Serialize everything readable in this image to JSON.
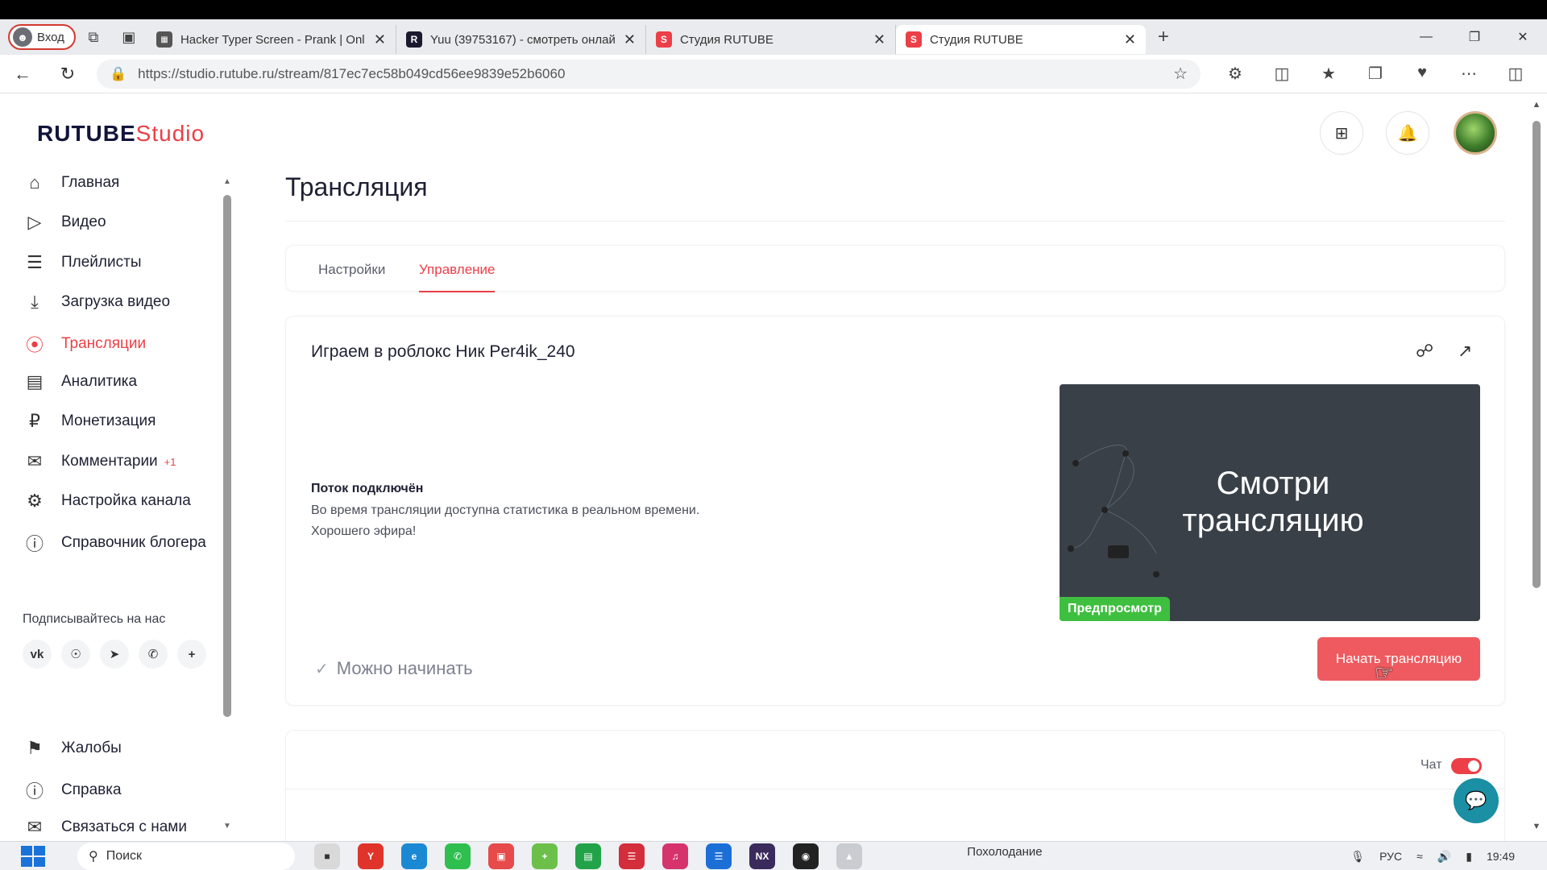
{
  "browser": {
    "profile_label": "Вход",
    "tabs": [
      {
        "title": "Hacker Typer Screen - Prank | Onl",
        "favicon": "HT",
        "color": "#555555"
      },
      {
        "title": "Yuu (39753167) - смотреть онлай",
        "favicon": "R",
        "color": "#1a1a2e"
      },
      {
        "title": "Студия RUTUBE",
        "favicon": "S",
        "color": "#ec3f47"
      },
      {
        "title": "Студия RUTUBE",
        "favicon": "S",
        "color": "#ec3f47"
      }
    ],
    "close_glyph": "✕",
    "new_tab_glyph": "+",
    "url": "https://studio.rutube.ru/stream/817ec7ec58b049cd56ee9839e52b6060"
  },
  "app": {
    "logo_main": "RUTUBE",
    "logo_studio": "Studio",
    "accent_color": "#ec3f47"
  },
  "sidebar": {
    "items": [
      {
        "label": "Главная",
        "icon": "home-icon"
      },
      {
        "label": "Видео",
        "icon": "video-icon"
      },
      {
        "label": "Плейлисты",
        "icon": "playlist-icon"
      },
      {
        "label": "Загрузка видео",
        "icon": "upload-icon"
      },
      {
        "label": "Трансляции",
        "icon": "broadcast-icon",
        "active": true
      },
      {
        "label": "Аналитика",
        "icon": "analytics-icon"
      },
      {
        "label": "Монетизация",
        "icon": "ruble-icon"
      },
      {
        "label": "Комментарии",
        "icon": "comment-icon",
        "badge": "+1"
      },
      {
        "label": "Настройка канала",
        "icon": "gear-icon"
      },
      {
        "label": "Справочник блогера",
        "icon": "info-icon"
      }
    ],
    "subscribe_title": "Подписывайтесь на нас",
    "socials": [
      "vk",
      "ok",
      "telegram",
      "viber",
      "more"
    ],
    "bottom_items": [
      {
        "label": "Жалобы",
        "icon": "flag-icon"
      },
      {
        "label": "Справка",
        "icon": "help-icon"
      },
      {
        "label": "Связаться с нами",
        "icon": "mail-icon"
      }
    ]
  },
  "main": {
    "page_title": "Трансляция",
    "tabs": [
      {
        "label": "Настройки"
      },
      {
        "label": "Управление",
        "active": true
      }
    ],
    "stream": {
      "title": "Играем в роблокс Ник Per4ik_240",
      "status_heading": "Поток подключён",
      "status_line1": "Во время трансляции доступна статистика в реальном времени.",
      "status_line2": "Хорошего эфира!",
      "ready_label": "Можно начинать",
      "preview_text": "Смотри трансляцию",
      "preview_badge": "Предпросмотр",
      "start_button": "Начать трансляцию"
    },
    "chat": {
      "label": "Чат",
      "enabled": true
    }
  },
  "taskbar": {
    "search_placeholder": "Поиск",
    "weather": "Похолодание",
    "lang": "РУС",
    "time": "19:49"
  }
}
